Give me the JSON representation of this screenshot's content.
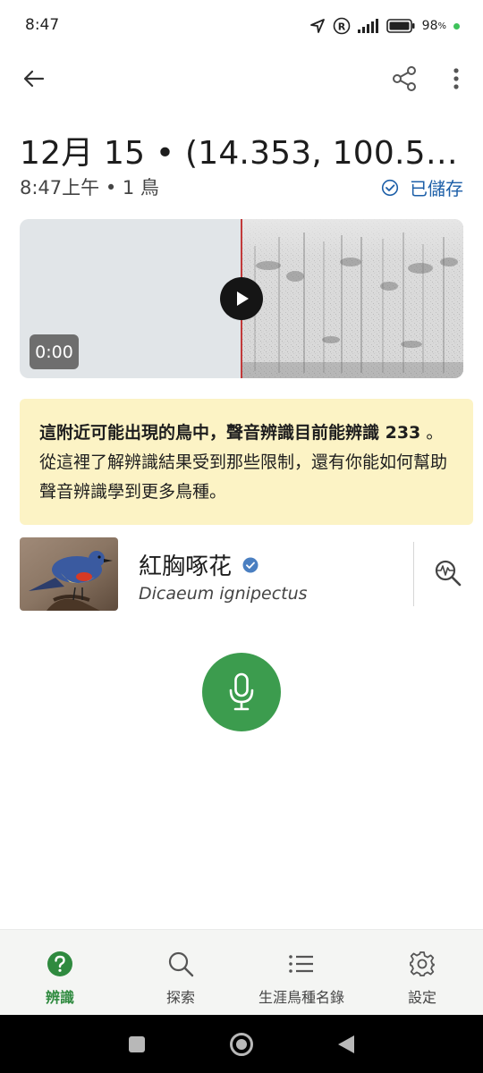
{
  "status_bar": {
    "time": "8:47",
    "battery_percent": "98",
    "battery_suffix": "%",
    "icons": [
      "location-arrow-icon",
      "registered-icon",
      "signal-icon",
      "battery-icon"
    ]
  },
  "app_bar": {
    "icons": [
      "back-arrow-icon",
      "share-icon",
      "more-vert-icon"
    ]
  },
  "recording": {
    "title": "12月 15 • (14.353, 100.56...",
    "subtitle": "8:47上午 • 1 鳥",
    "saved_label": "已儲存",
    "player": {
      "time": "0:00",
      "playhead_color": "#c23a3a"
    }
  },
  "notice": {
    "bold_text": "這附近可能出現的鳥中，聲音辨識目前能辨識 233",
    "rest_text": " 。 從這裡了解辨識結果受到那些限制，還有你能如何幫助聲音辨識學到更多鳥種。"
  },
  "species": {
    "common_name": "紅胸啄花",
    "scientific_name": "Dicaeum ignipectus",
    "verified_icon": "check-badge-icon",
    "analyze_icon": "waveform-search-icon"
  },
  "mic": {
    "icon": "microphone-icon",
    "color": "#3c9c4e"
  },
  "bottom_nav": {
    "items": [
      {
        "label": "辨識",
        "icon": "question-circle-icon",
        "active": true
      },
      {
        "label": "探索",
        "icon": "search-icon",
        "active": false
      },
      {
        "label": "生涯鳥種名錄",
        "icon": "list-icon",
        "active": false
      },
      {
        "label": "設定",
        "icon": "gear-icon",
        "active": false
      }
    ],
    "active_color": "#2f8a3f"
  },
  "system_nav": {
    "icons": [
      "recents-square-icon",
      "home-circle-icon",
      "back-triangle-icon"
    ]
  }
}
